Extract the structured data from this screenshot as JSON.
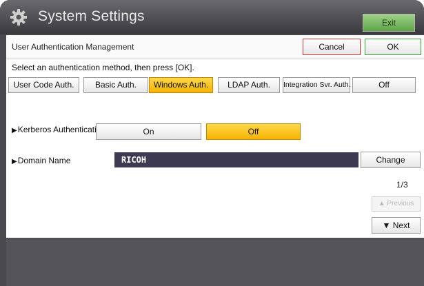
{
  "window": {
    "title": "System Settings",
    "exit_label": "Exit"
  },
  "header": {
    "title": "User Authentication Management",
    "cancel_label": "Cancel",
    "ok_label": "OK"
  },
  "instruction": "Select an authentication method, then press [OK].",
  "auth_methods": [
    {
      "label": "User Code Auth.",
      "selected": false
    },
    {
      "label": "Basic Auth.",
      "selected": false
    },
    {
      "label": "Windows Auth.",
      "selected": true
    },
    {
      "label": "LDAP Auth.",
      "selected": false
    },
    {
      "label": "Integration Svr. Auth.",
      "selected": false
    },
    {
      "label": "Off",
      "selected": false
    }
  ],
  "kerberos": {
    "label": "Kerberos Authentication",
    "on_label": "On",
    "off_label": "Off",
    "selected": "Off"
  },
  "domain": {
    "label": "Domain Name",
    "value": "RICOH",
    "change_label": "Change"
  },
  "pagination": {
    "indicator": "1/3",
    "previous_label": "Previous",
    "next_label": "Next"
  },
  "colors": {
    "selected": "#f5b400",
    "field_bg": "#3d3a52",
    "cancel_border": "#cc3333",
    "ok_border": "#3a9a3a",
    "exit_bg": "#6fb255"
  }
}
